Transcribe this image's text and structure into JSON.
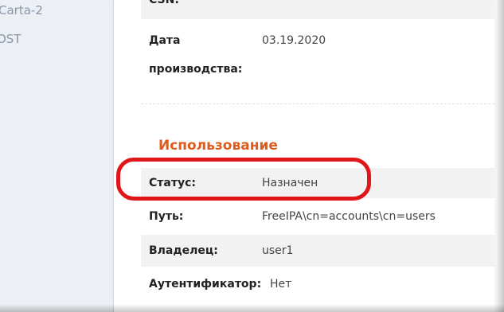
{
  "sidebar": {
    "items": [
      {
        "label": "Carta-2"
      },
      {
        "label": "OST"
      }
    ]
  },
  "top_row": {
    "label": "CSN:"
  },
  "manufacture_date": {
    "label_line1": "Дата",
    "label_line2": "производства:",
    "value": "03.19.2020"
  },
  "usage": {
    "title": "Использование",
    "rows": [
      {
        "label": "Статус:",
        "value": "Назначен"
      },
      {
        "label": "Путь:",
        "value": "FreeIPA\\cn=accounts\\cn=users"
      },
      {
        "label": "Владелец:",
        "value": "user1"
      },
      {
        "label": "Аутентификатор:",
        "value": "Нет"
      }
    ]
  },
  "colors": {
    "section_title": "#e05a1b",
    "highlight": "#e0161b",
    "sidebar_bg": "#eceff3",
    "row_shade": "#f2f2f2"
  }
}
